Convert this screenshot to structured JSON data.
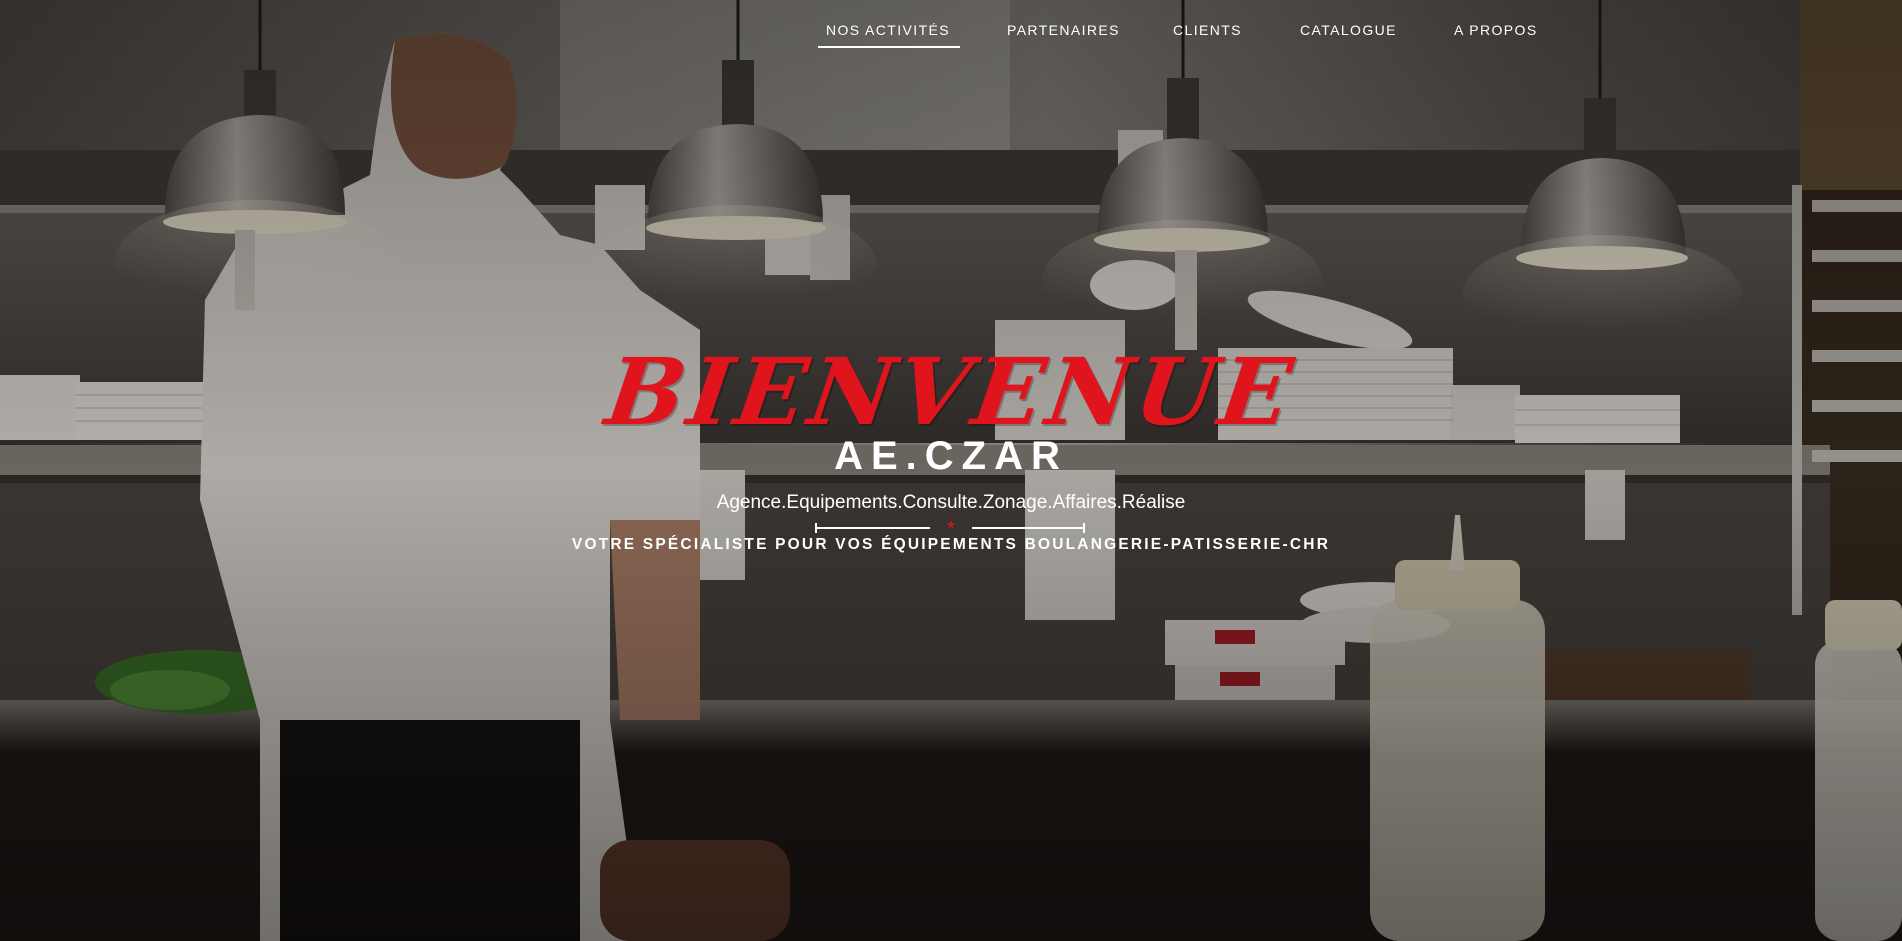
{
  "nav": {
    "items": [
      {
        "label": "NOS ACTIVITÉS",
        "active": true
      },
      {
        "label": "PARTENAIRES",
        "active": false
      },
      {
        "label": "CLIENTS",
        "active": false
      },
      {
        "label": "CATALOGUE",
        "active": false
      },
      {
        "label": "A PROPOS",
        "active": false
      }
    ]
  },
  "hero": {
    "welcome": "Bienvenue",
    "brand": "AE.CZAR",
    "acronym": "Agence.Equipements.Consulte.Zonage.Affaires.Réalise",
    "divider_symbol": "*",
    "tagline": "VOTRE SPÉCIALISTE POUR VOS ÉQUIPEMENTS BOULANGERIE-PATISSERIE-CHR"
  },
  "colors": {
    "accent_red": "#e0141c",
    "text_white": "#ffffff"
  }
}
